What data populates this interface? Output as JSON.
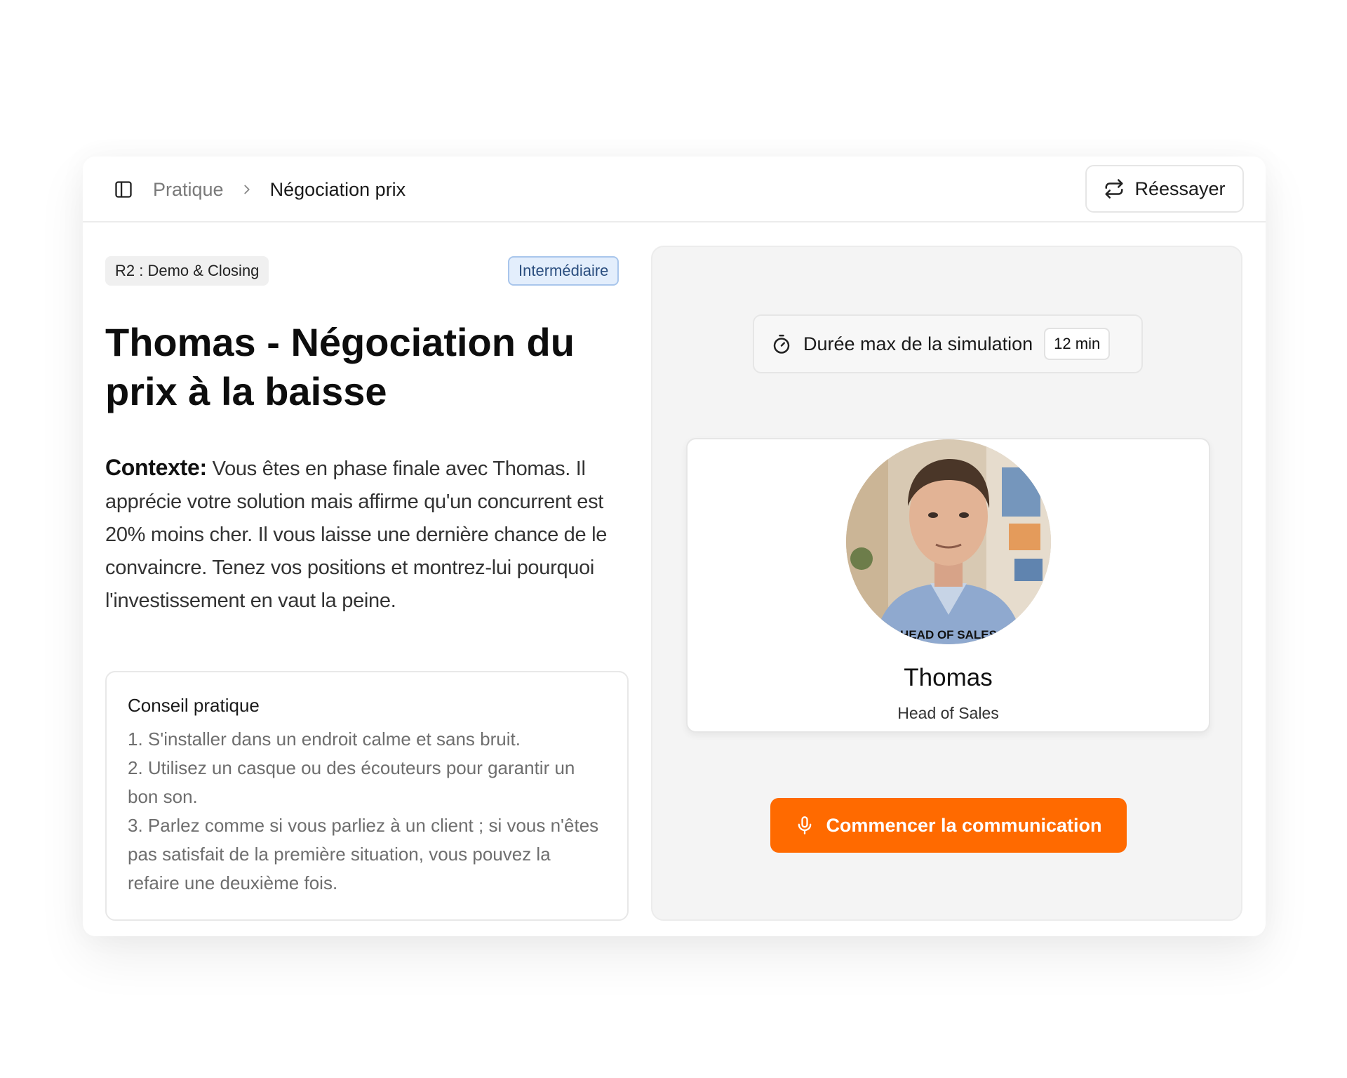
{
  "colors": {
    "accent": "#ff6a00",
    "badge_bg": "#e3eefc",
    "badge_border": "#a9c6ec",
    "panel_bg": "#f4f4f4"
  },
  "header": {
    "sidebar_icon": "sidebar-toggle-icon",
    "breadcrumb": {
      "root": "Pratique",
      "separator_icon": "chevron-right-icon",
      "current": "Négociation prix"
    },
    "retry_button": {
      "icon": "repeat-icon",
      "label": "Réessayer"
    }
  },
  "scenario": {
    "tag": "R2 : Demo & Closing",
    "level": "Intermédiaire",
    "title": "Thomas - Négociation du prix à la baisse",
    "context_label": "Contexte:",
    "context_text": " Vous êtes en phase finale avec Thomas. Il apprécie votre solution mais affirme qu'un concurrent est 20% moins cher. Il vous laisse une dernière chance de le convaincre. Tenez vos positions et montrez-lui pourquoi l'investissement en vaut la peine."
  },
  "advice": {
    "title": "Conseil pratique",
    "items": [
      "1. S'installer dans un endroit calme et sans bruit.",
      "2. Utilisez un casque ou des écouteurs pour garantir un bon son.",
      "3. Parlez comme si vous parliez à un client ; si vous n'êtes pas satisfait de la première situation, vous pouvez la refaire une deuxième fois."
    ]
  },
  "simulation": {
    "duration_icon": "stopwatch-icon",
    "duration_label": "Durée max de la simulation",
    "duration_value": "12 min"
  },
  "persona": {
    "avatar_caption": "HEAD OF SALES",
    "name": "Thomas",
    "role": "Head of Sales"
  },
  "start_button": {
    "icon": "microphone-icon",
    "label": "Commencer la communication"
  }
}
